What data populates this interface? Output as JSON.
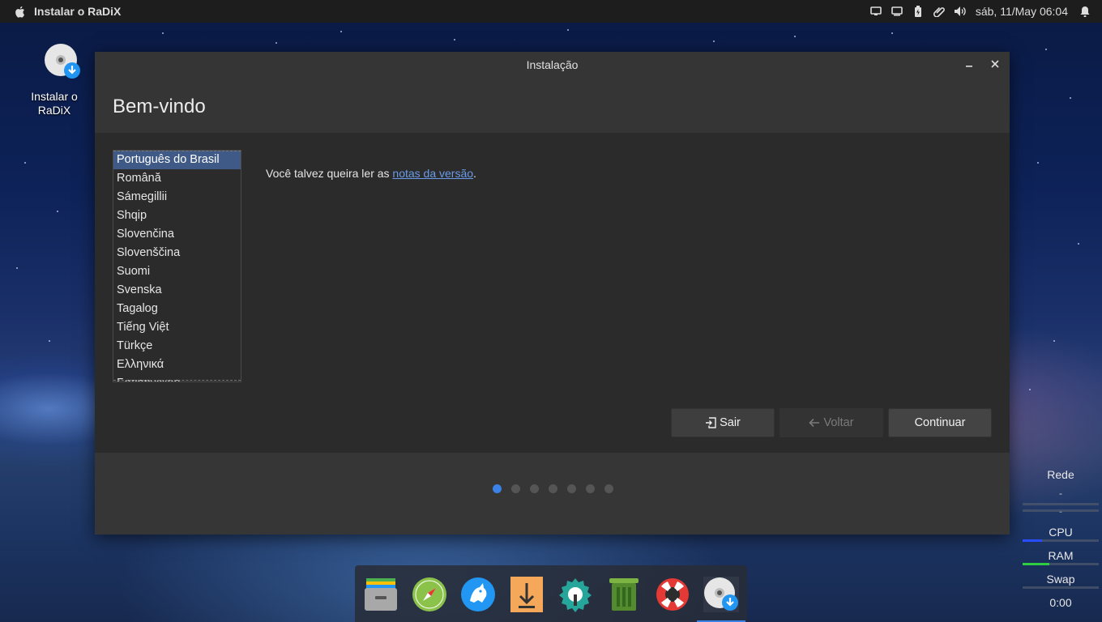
{
  "topbar": {
    "app_title": "Instalar o RaDiX",
    "clock": "sáb, 11/May  06:04",
    "tray_icons": [
      "screen-icon",
      "display-icon",
      "battery-icon",
      "clip-icon",
      "volume-icon"
    ],
    "notification_icon": "bell-icon"
  },
  "desktop": {
    "install_icon_label": "Instalar o RaDiX"
  },
  "window": {
    "title": "Instalação",
    "header": "Bem-vindo",
    "languages": [
      "Português do Brasil",
      "Română",
      "Sámegillii",
      "Shqip",
      "Slovenčina",
      "Slovenščina",
      "Suomi",
      "Svenska",
      "Tagalog",
      "Tiếng Việt",
      "Türkçe",
      "Ελληνικά",
      "Беларуская"
    ],
    "selected_language": "Português do Brasil",
    "notes_prefix": "Você talvez queira ler as ",
    "notes_link": "notas da versão",
    "notes_suffix": ".",
    "buttons": {
      "quit": "Sair",
      "back": "Voltar",
      "continue": "Continuar"
    },
    "progress": {
      "steps": 7,
      "current": 1
    }
  },
  "dock": {
    "items": [
      "files-icon",
      "browser-icon",
      "messenger-icon",
      "downloader-icon",
      "settings-icon",
      "trash-icon",
      "help-icon",
      "installer-icon"
    ]
  },
  "monitor": {
    "net_label": "Rede",
    "net_up": "-",
    "net_down": "-",
    "cpu_label": "CPU",
    "cpu_usage": 0.25,
    "ram_label": "RAM",
    "ram_usage": 0.35,
    "swap_label": "Swap",
    "swap_usage": 0.0,
    "uptime": "0:00",
    "colors": {
      "cpu": "#2a4cff",
      "ram": "#2ecc40"
    }
  }
}
